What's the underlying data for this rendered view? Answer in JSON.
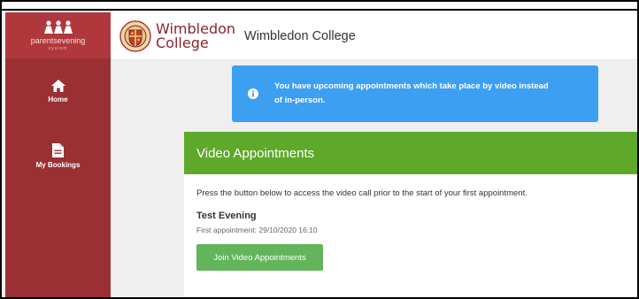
{
  "sidebar": {
    "brand": {
      "name": "parentsevening",
      "sub": "system"
    },
    "items": [
      {
        "label": "Home",
        "icon": "home-icon"
      },
      {
        "label": "My Bookings",
        "icon": "file-icon"
      }
    ]
  },
  "header": {
    "logo_line1": "Wimbledon",
    "logo_line2": "College",
    "title": "Wimbledon College"
  },
  "alert": {
    "text": "You have upcoming appointments which take place by video instead of in-person.",
    "icon": "info-icon"
  },
  "card": {
    "title": "Video Appointments",
    "description": "Press the button below to access the video call prior to the start of your first appointment.",
    "event_name": "Test Evening",
    "first_appointment": "First appointment: 29/10/2020 16:10",
    "button_label": "Join Video Appointments"
  },
  "colors": {
    "sidebar": "#9a3034",
    "brand_bg": "#b0383d",
    "alert": "#3d9ff1",
    "card_header": "#5ea82a",
    "button": "#62b55b"
  }
}
